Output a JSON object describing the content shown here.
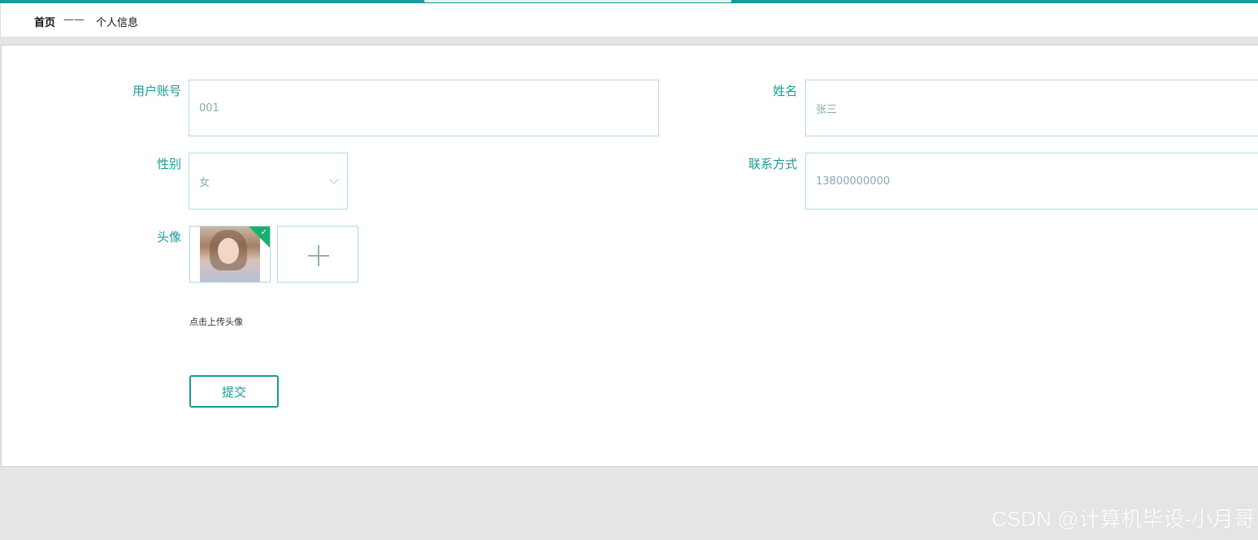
{
  "breadcrumb": {
    "home": "首页",
    "separator": "——",
    "current": "个人信息"
  },
  "form": {
    "account": {
      "label": "用户账号",
      "value": "001"
    },
    "name": {
      "label": "姓名",
      "value": "张三"
    },
    "gender": {
      "label": "性别",
      "value": "女"
    },
    "contact": {
      "label": "联系方式",
      "value": "13800000000"
    },
    "avatar": {
      "label": "头像",
      "hint": "点击上传头像"
    },
    "submit_label": "提交"
  },
  "watermark": "CSDN @计算机毕设-小月哥",
  "colors": {
    "accent": "#1a9a9a",
    "upload_success": "#18b06e"
  }
}
